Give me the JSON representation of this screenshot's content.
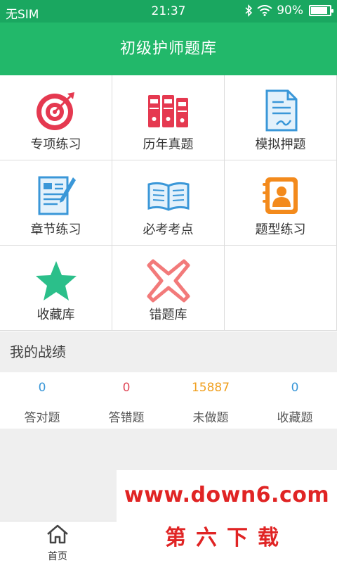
{
  "status_bar": {
    "carrier": "无SIM",
    "time": "21:37",
    "battery": "90%",
    "battery_level": 0.9
  },
  "header": {
    "title": "初级护师题库"
  },
  "grid": {
    "items": [
      {
        "label": "专项练习",
        "icon": "target-icon"
      },
      {
        "label": "历年真题",
        "icon": "binders-icon"
      },
      {
        "label": "模拟押题",
        "icon": "document-pen-icon"
      },
      {
        "label": "章节练习",
        "icon": "notepad-pencil-icon"
      },
      {
        "label": "必考考点",
        "icon": "open-book-icon"
      },
      {
        "label": "题型练习",
        "icon": "contact-book-icon"
      },
      {
        "label": "收藏库",
        "icon": "star-icon"
      },
      {
        "label": "错题库",
        "icon": "cross-icon"
      }
    ]
  },
  "record": {
    "title": "我的战绩",
    "stats": [
      {
        "value": "0",
        "label": "答对题",
        "color": "#3a97d8"
      },
      {
        "value": "0",
        "label": "答错题",
        "color": "#e04a5a"
      },
      {
        "value": "15887",
        "label": "未做题",
        "color": "#f0a020"
      },
      {
        "value": "0",
        "label": "收藏题",
        "color": "#3a97d8"
      }
    ]
  },
  "bottom_nav": {
    "home_label": "首页"
  },
  "watermark": {
    "url": "www.down6.com",
    "brand": "第六下载"
  },
  "colors": {
    "header": "#22b86a",
    "status_bar": "#1aa760"
  }
}
